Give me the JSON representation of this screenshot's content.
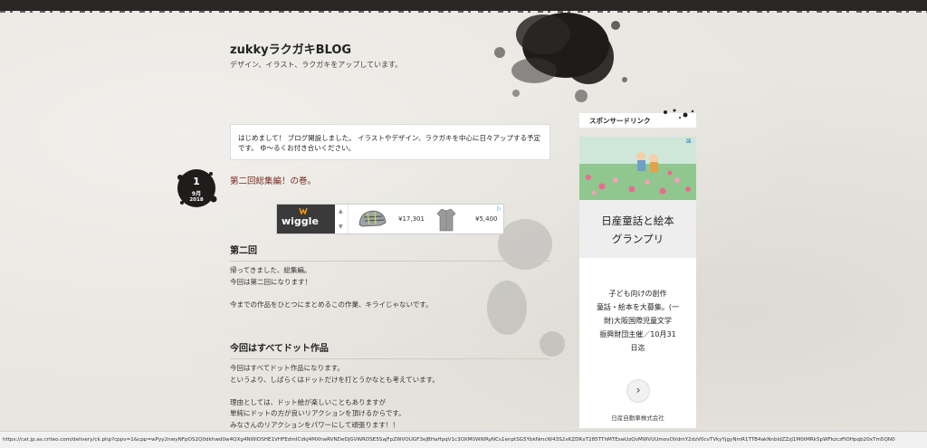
{
  "site": {
    "title": "zukkyラクガキBLOG",
    "description": "デザイン、イラスト、ラクガキをアップしています。"
  },
  "intro": {
    "line1": "はじめまして！ ブログ開設しました。 イラストやデザイン、ラクガキを中心に日々アップする予定",
    "line2": "です。 ゆ～るくお付き合いください。"
  },
  "post": {
    "date": {
      "day": "1",
      "month": "9月",
      "year": "2018"
    },
    "title": "第二回総集編！の巻。"
  },
  "banner_ad": {
    "brand": "wiggle",
    "price1": "¥17,301",
    "price2": "¥5,400",
    "colors": {
      "dark": "#3a3a3a",
      "orange": "#f39c12"
    }
  },
  "sections": [
    {
      "heading": "第二回",
      "lines": [
        "帰ってきました、総集編。",
        "今回は第二回になります！",
        "",
        "今までの作品をひとつにまとめるこの作業、キライじゃないです。"
      ]
    },
    {
      "heading": "今回はすべてドット作品",
      "lines": [
        "今回はすべてドット作品になります。",
        "というより、しばらくはドットだけを打とうかなとも考えています。",
        "",
        "理由としては、ドット絵が楽しいこともありますが",
        "単純にドットの方が良いリアクションを頂けるからです。",
        "みなさんのリアクションをパワーにして頑張ります！！"
      ]
    }
  ],
  "sidebar": {
    "header": "スポンサードリンク",
    "ad": {
      "title_line1": "日産童話と絵本",
      "title_line2": "グランプリ",
      "copy": [
        "子ども向けの創作",
        "童話・絵本を大募集。(一",
        "財)大阪国際児童文学",
        "振興財団主催／10月31",
        "日迄"
      ],
      "next_icon": "chevron-right-icon",
      "sponsor": "日産自動車株式会社"
    }
  },
  "status_bar": {
    "url": "https://cat.jp.as.criteo.com/delivery/ck.php?cppv=1&cpp=wPyy2nwyNFpOS2Q0dkhwd0w4QXg4NWlOSHE1VHFEdmlCdkJ4MXhwRVNDeDJGVWRDSE5SajFpZWVOUGF3ejBHaHpqV1c3OXM0WWRyNCs1enptSG5YbkNmcW43S2xKZDRxT285TThMTEswUzQvMWVUUmovOVdmY2dzV0cvTVkyYjgyNmR1TTB4akNnbldZZzJ1M0tMRk5pWFkzczFiOHpqb20xTm5QN0"
  }
}
